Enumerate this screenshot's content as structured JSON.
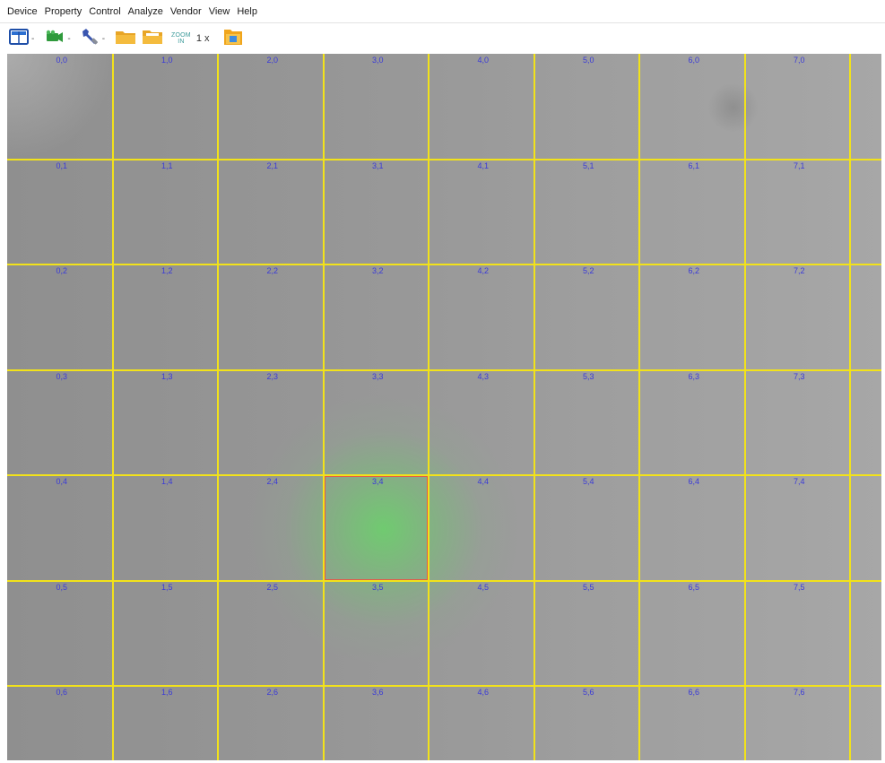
{
  "menu": {
    "items": [
      {
        "label": "Device"
      },
      {
        "label": "Property"
      },
      {
        "label": "Control"
      },
      {
        "label": "Analyze"
      },
      {
        "label": "Vendor"
      },
      {
        "label": "View"
      },
      {
        "label": "Help"
      }
    ]
  },
  "toolbar": {
    "dropdown_arrow": "-",
    "zoom_icon_top": "ZOOM",
    "zoom_icon_bottom": "IN",
    "zoom_value": "1 x",
    "icons": [
      "display-layout-icon",
      "camera-icon",
      "wrench-icon",
      "folder-icon",
      "open-folder-icon",
      "zoom-in-icon",
      "export-folder-icon"
    ]
  },
  "viewport": {
    "columns": [
      "0",
      "1",
      "2",
      "3",
      "4",
      "5",
      "6",
      "7"
    ],
    "rows": [
      "0",
      "1",
      "2",
      "3",
      "4",
      "5",
      "6"
    ],
    "cell_labels": [
      [
        "0,0",
        "1,0",
        "2,0",
        "3,0",
        "4,0",
        "5,0",
        "6,0",
        "7,0"
      ],
      [
        "0,1",
        "1,1",
        "2,1",
        "3,1",
        "4,1",
        "5,1",
        "6,1",
        "7,1"
      ],
      [
        "0,2",
        "1,2",
        "2,2",
        "3,2",
        "4,2",
        "5,2",
        "6,2",
        "7,2"
      ],
      [
        "0,3",
        "1,3",
        "2,3",
        "3,3",
        "4,3",
        "5,3",
        "6,3",
        "7,3"
      ],
      [
        "0,4",
        "1,4",
        "2,4",
        "3,4",
        "4,4",
        "5,4",
        "6,4",
        "7,4"
      ],
      [
        "0,5",
        "1,5",
        "2,5",
        "3,5",
        "4,5",
        "5,5",
        "6,5",
        "7,5"
      ],
      [
        "0,6",
        "1,6",
        "2,6",
        "3,6",
        "4,6",
        "5,6",
        "6,6",
        "7,6"
      ]
    ],
    "selected_cell": "3,4",
    "colors": {
      "grid_line": "#f2e21a",
      "cell_label": "#3a3ad8",
      "selection": "#e05a4a",
      "light_spot": "#6ecd6e"
    }
  }
}
